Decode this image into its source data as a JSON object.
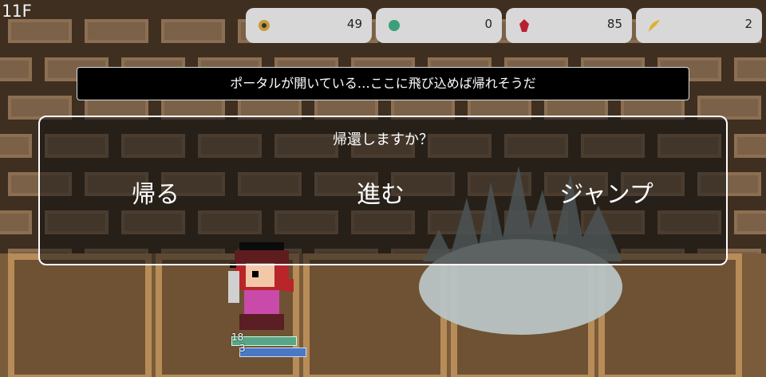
{
  "hud": {
    "floor": "11F",
    "resources": [
      {
        "icon": "coin-icon",
        "value": "49",
        "color": "#c89a3a"
      },
      {
        "icon": "green-orb-icon",
        "value": "0",
        "color": "#3aa07a"
      },
      {
        "icon": "red-gem-icon",
        "value": "85",
        "color": "#b82030"
      },
      {
        "icon": "feather-icon",
        "value": "2",
        "color": "#e0b030"
      }
    ]
  },
  "message": "ポータルが開いている…ここに飛び込めば帰れそうだ",
  "dialog": {
    "question": "帰還しますか？",
    "choices": [
      "帰る",
      "進む",
      "ジャンプ"
    ]
  },
  "player": {
    "hp": "18",
    "mp": "3",
    "hp_ratio": 1.0,
    "mp_ratio": 1.0
  },
  "colors": {
    "hp": "#5aa58a",
    "mp": "#4a78c6",
    "dialog_border": "#ffffff"
  }
}
